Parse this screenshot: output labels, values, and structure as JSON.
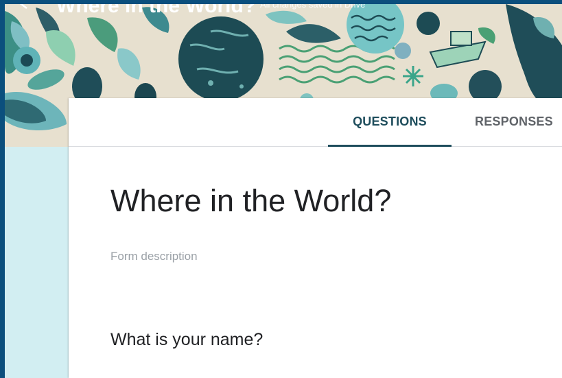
{
  "app_bar": {
    "title": "Where in the World?",
    "subtitle": "All changes saved in Drive"
  },
  "tabs": [
    {
      "label": "QUESTIONS",
      "active": true
    },
    {
      "label": "RESPONSES",
      "active": false
    }
  ],
  "form": {
    "title": "Where in the World?",
    "description_placeholder": "Form description",
    "questions": [
      {
        "text": "What is your name?"
      }
    ]
  },
  "colors": {
    "accent": "#1e4d5c",
    "frame": "#0b4f7d",
    "side_panel": "#d2eef2",
    "header_background": "#e7e0cf"
  },
  "icons": {
    "back": "arrow-back-icon"
  }
}
